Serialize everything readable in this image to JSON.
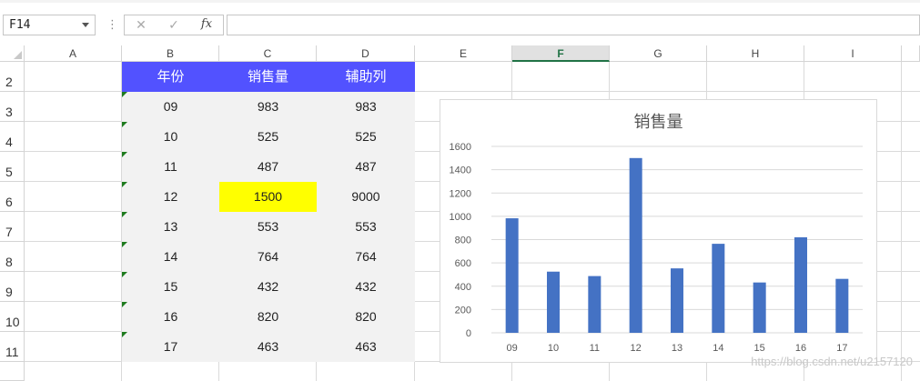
{
  "formula_bar": {
    "name_box": "F14",
    "cancel_icon": "✕",
    "enter_icon": "✓",
    "fx_label": "fx",
    "formula_value": ""
  },
  "columns": [
    "A",
    "B",
    "C",
    "D",
    "E",
    "F",
    "G",
    "H",
    "I"
  ],
  "selected_column": "F",
  "rows": [
    "2",
    "3",
    "4",
    "5",
    "6",
    "7",
    "8",
    "9",
    "10",
    "11"
  ],
  "table": {
    "headers": [
      "年份",
      "销售量",
      "辅助列"
    ],
    "header_color": "#5252ff",
    "body_color": "#f2f2f2",
    "highlight_color": "#ffff00",
    "rows": [
      [
        "09",
        "983",
        "983"
      ],
      [
        "10",
        "525",
        "525"
      ],
      [
        "11",
        "487",
        "487"
      ],
      [
        "12",
        "1500",
        "9000"
      ],
      [
        "13",
        "553",
        "553"
      ],
      [
        "14",
        "764",
        "764"
      ],
      [
        "15",
        "432",
        "432"
      ],
      [
        "16",
        "820",
        "820"
      ],
      [
        "17",
        "463",
        "463"
      ]
    ]
  },
  "chart_data": {
    "type": "bar",
    "title": "销售量",
    "categories": [
      "09",
      "10",
      "11",
      "12",
      "13",
      "14",
      "15",
      "16",
      "17"
    ],
    "values": [
      983,
      525,
      487,
      1500,
      553,
      764,
      432,
      820,
      463
    ],
    "y_ticks": [
      0,
      200,
      400,
      600,
      800,
      1000,
      1200,
      1400,
      1600
    ],
    "ylim": [
      0,
      1600
    ],
    "grid": true,
    "bar_color": "#4472c4"
  },
  "watermark": "https://blog.csdn.net/u2157120"
}
